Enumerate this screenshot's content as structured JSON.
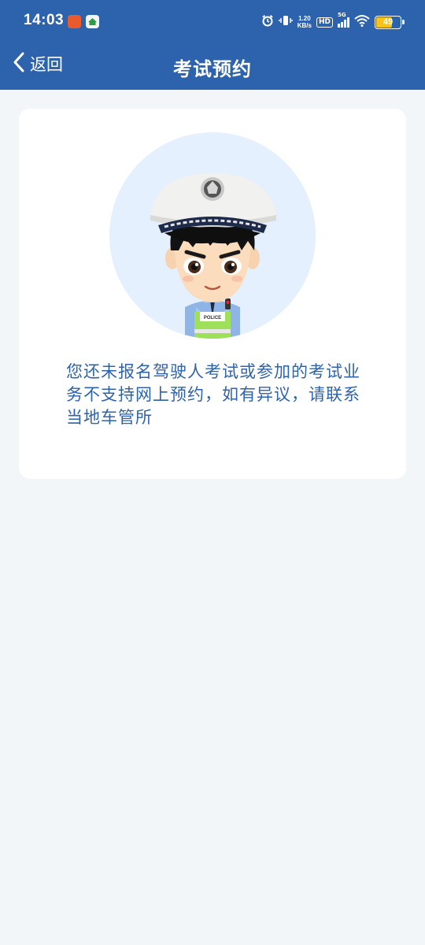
{
  "status_bar": {
    "time": "14:03",
    "net_speed_value": "1.20",
    "net_speed_unit": "KB/s",
    "hd_label": "HD",
    "network_label": "5G",
    "battery_level": "49",
    "icons": [
      "app-icon-orange",
      "app-icon-home",
      "alarm-icon",
      "vibrate-icon",
      "signal-icon",
      "wifi-icon",
      "battery-icon"
    ]
  },
  "nav": {
    "back_label": "返回",
    "title": "考试预约"
  },
  "card": {
    "badge_text": "POLICE",
    "message": "您还未报名驾驶人考试或参加的考试业务不支持网上预约，如有异议，请联系当地车管所"
  },
  "colors": {
    "header_bg": "#2d63ad",
    "page_bg": "#f3f6f8",
    "card_bg": "#ffffff",
    "message_text": "#2d63ad",
    "avatar_circle": "#e4f0fd",
    "battery_fill": "#f6c21b"
  }
}
